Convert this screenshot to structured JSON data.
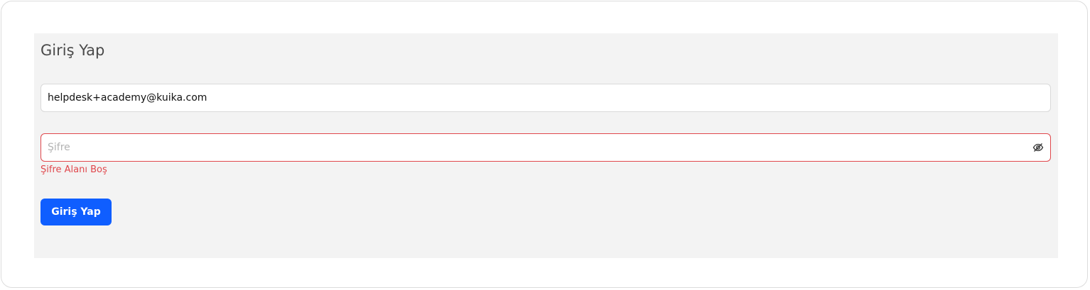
{
  "form": {
    "title": "Giriş Yap",
    "email": {
      "value": "helpdesk+academy@kuika.com",
      "placeholder": ""
    },
    "password": {
      "value": "",
      "placeholder": "Şifre",
      "toggle_icon": "eye-slash-icon",
      "error": "Şifre Alanı Boş"
    },
    "submit_label": "Giriş Yap"
  },
  "colors": {
    "accent": "#0f5eff",
    "error": "#e0474c",
    "panel_bg": "#f3f3f3"
  }
}
